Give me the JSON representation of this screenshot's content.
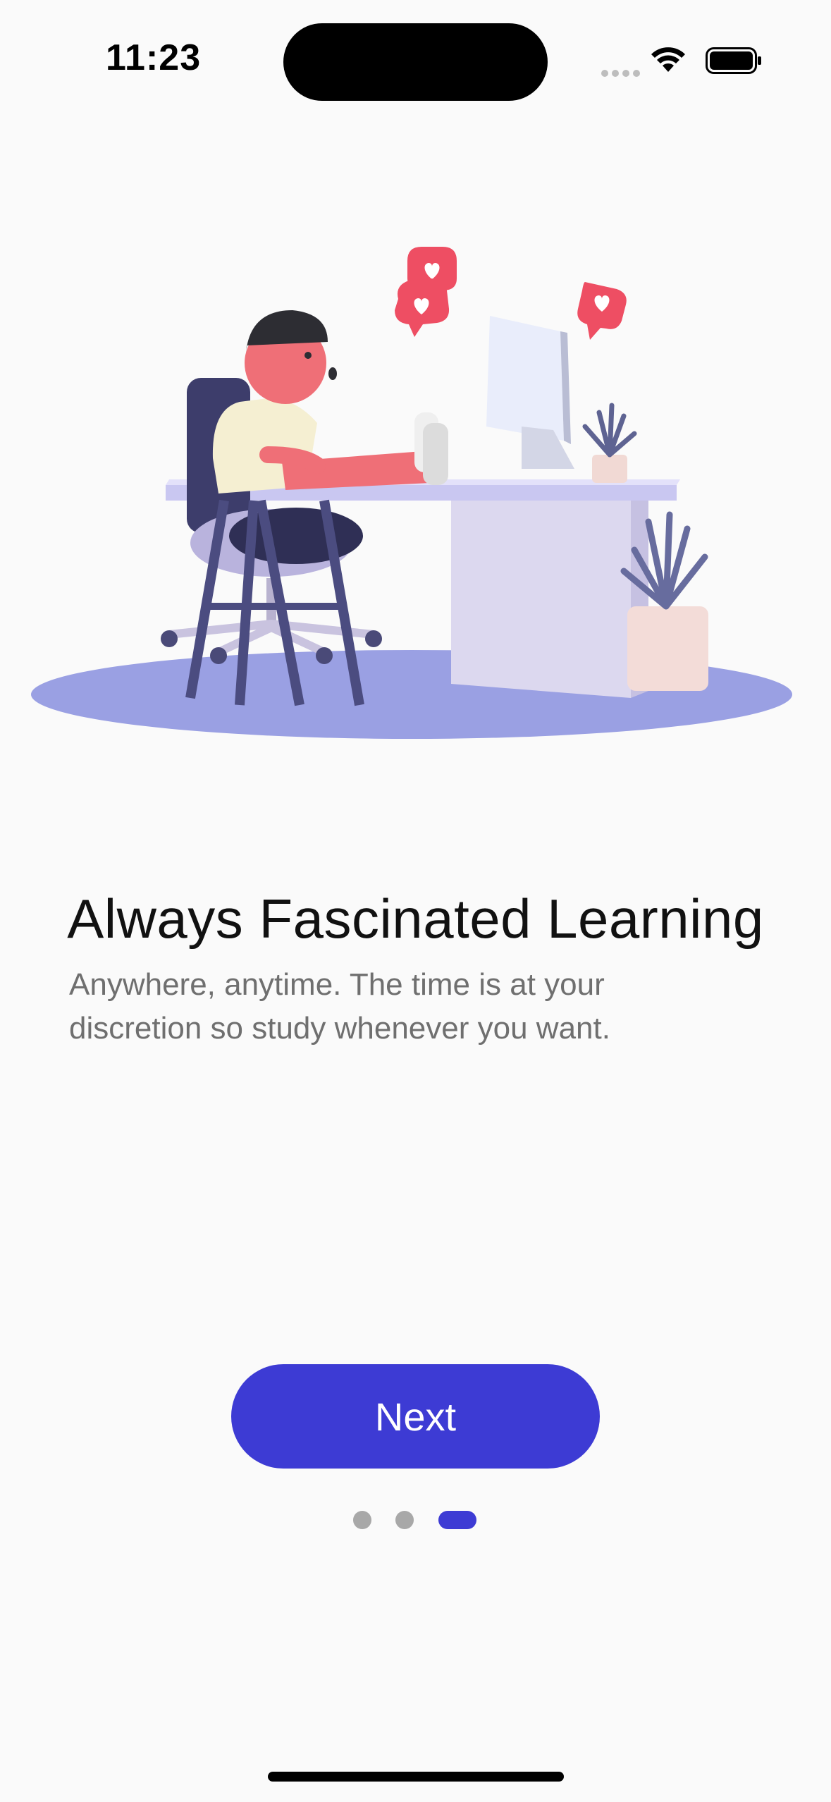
{
  "status_bar": {
    "time": "11:23",
    "icons": [
      "cellular-icon",
      "wifi-icon",
      "battery-icon"
    ]
  },
  "onboarding": {
    "title": "Always Fascinated Learning",
    "subtitle": "Anywhere, anytime. The time is at your discretion so study whenever you want.",
    "next_label": "Next",
    "page_count": 3,
    "current_page": 3
  },
  "colors": {
    "accent": "#3d3bd4",
    "background": "#fafafa",
    "inactive_dot": "#a8a8a8"
  }
}
